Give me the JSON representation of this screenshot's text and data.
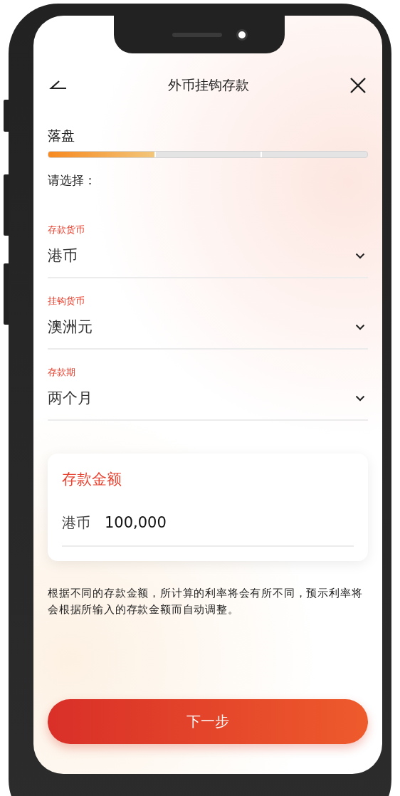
{
  "header": {
    "title": "外币挂钩存款"
  },
  "step": {
    "label": "落盘",
    "level": 0.333
  },
  "prompt": "请选择：",
  "fields": [
    {
      "label": "存款货币",
      "value": "港币"
    },
    {
      "label": "挂钩货币",
      "value": "澳洲元"
    },
    {
      "label": "存款期",
      "value": "两个月"
    }
  ],
  "amount": {
    "title": "存款金额",
    "currency": "港币",
    "value": "100,000"
  },
  "note": "根据不同的存款金额，所计算的利率将会有所不同，预示利率将会根据所输入的存款金额而自动调整。",
  "button": {
    "label": "下一步"
  }
}
